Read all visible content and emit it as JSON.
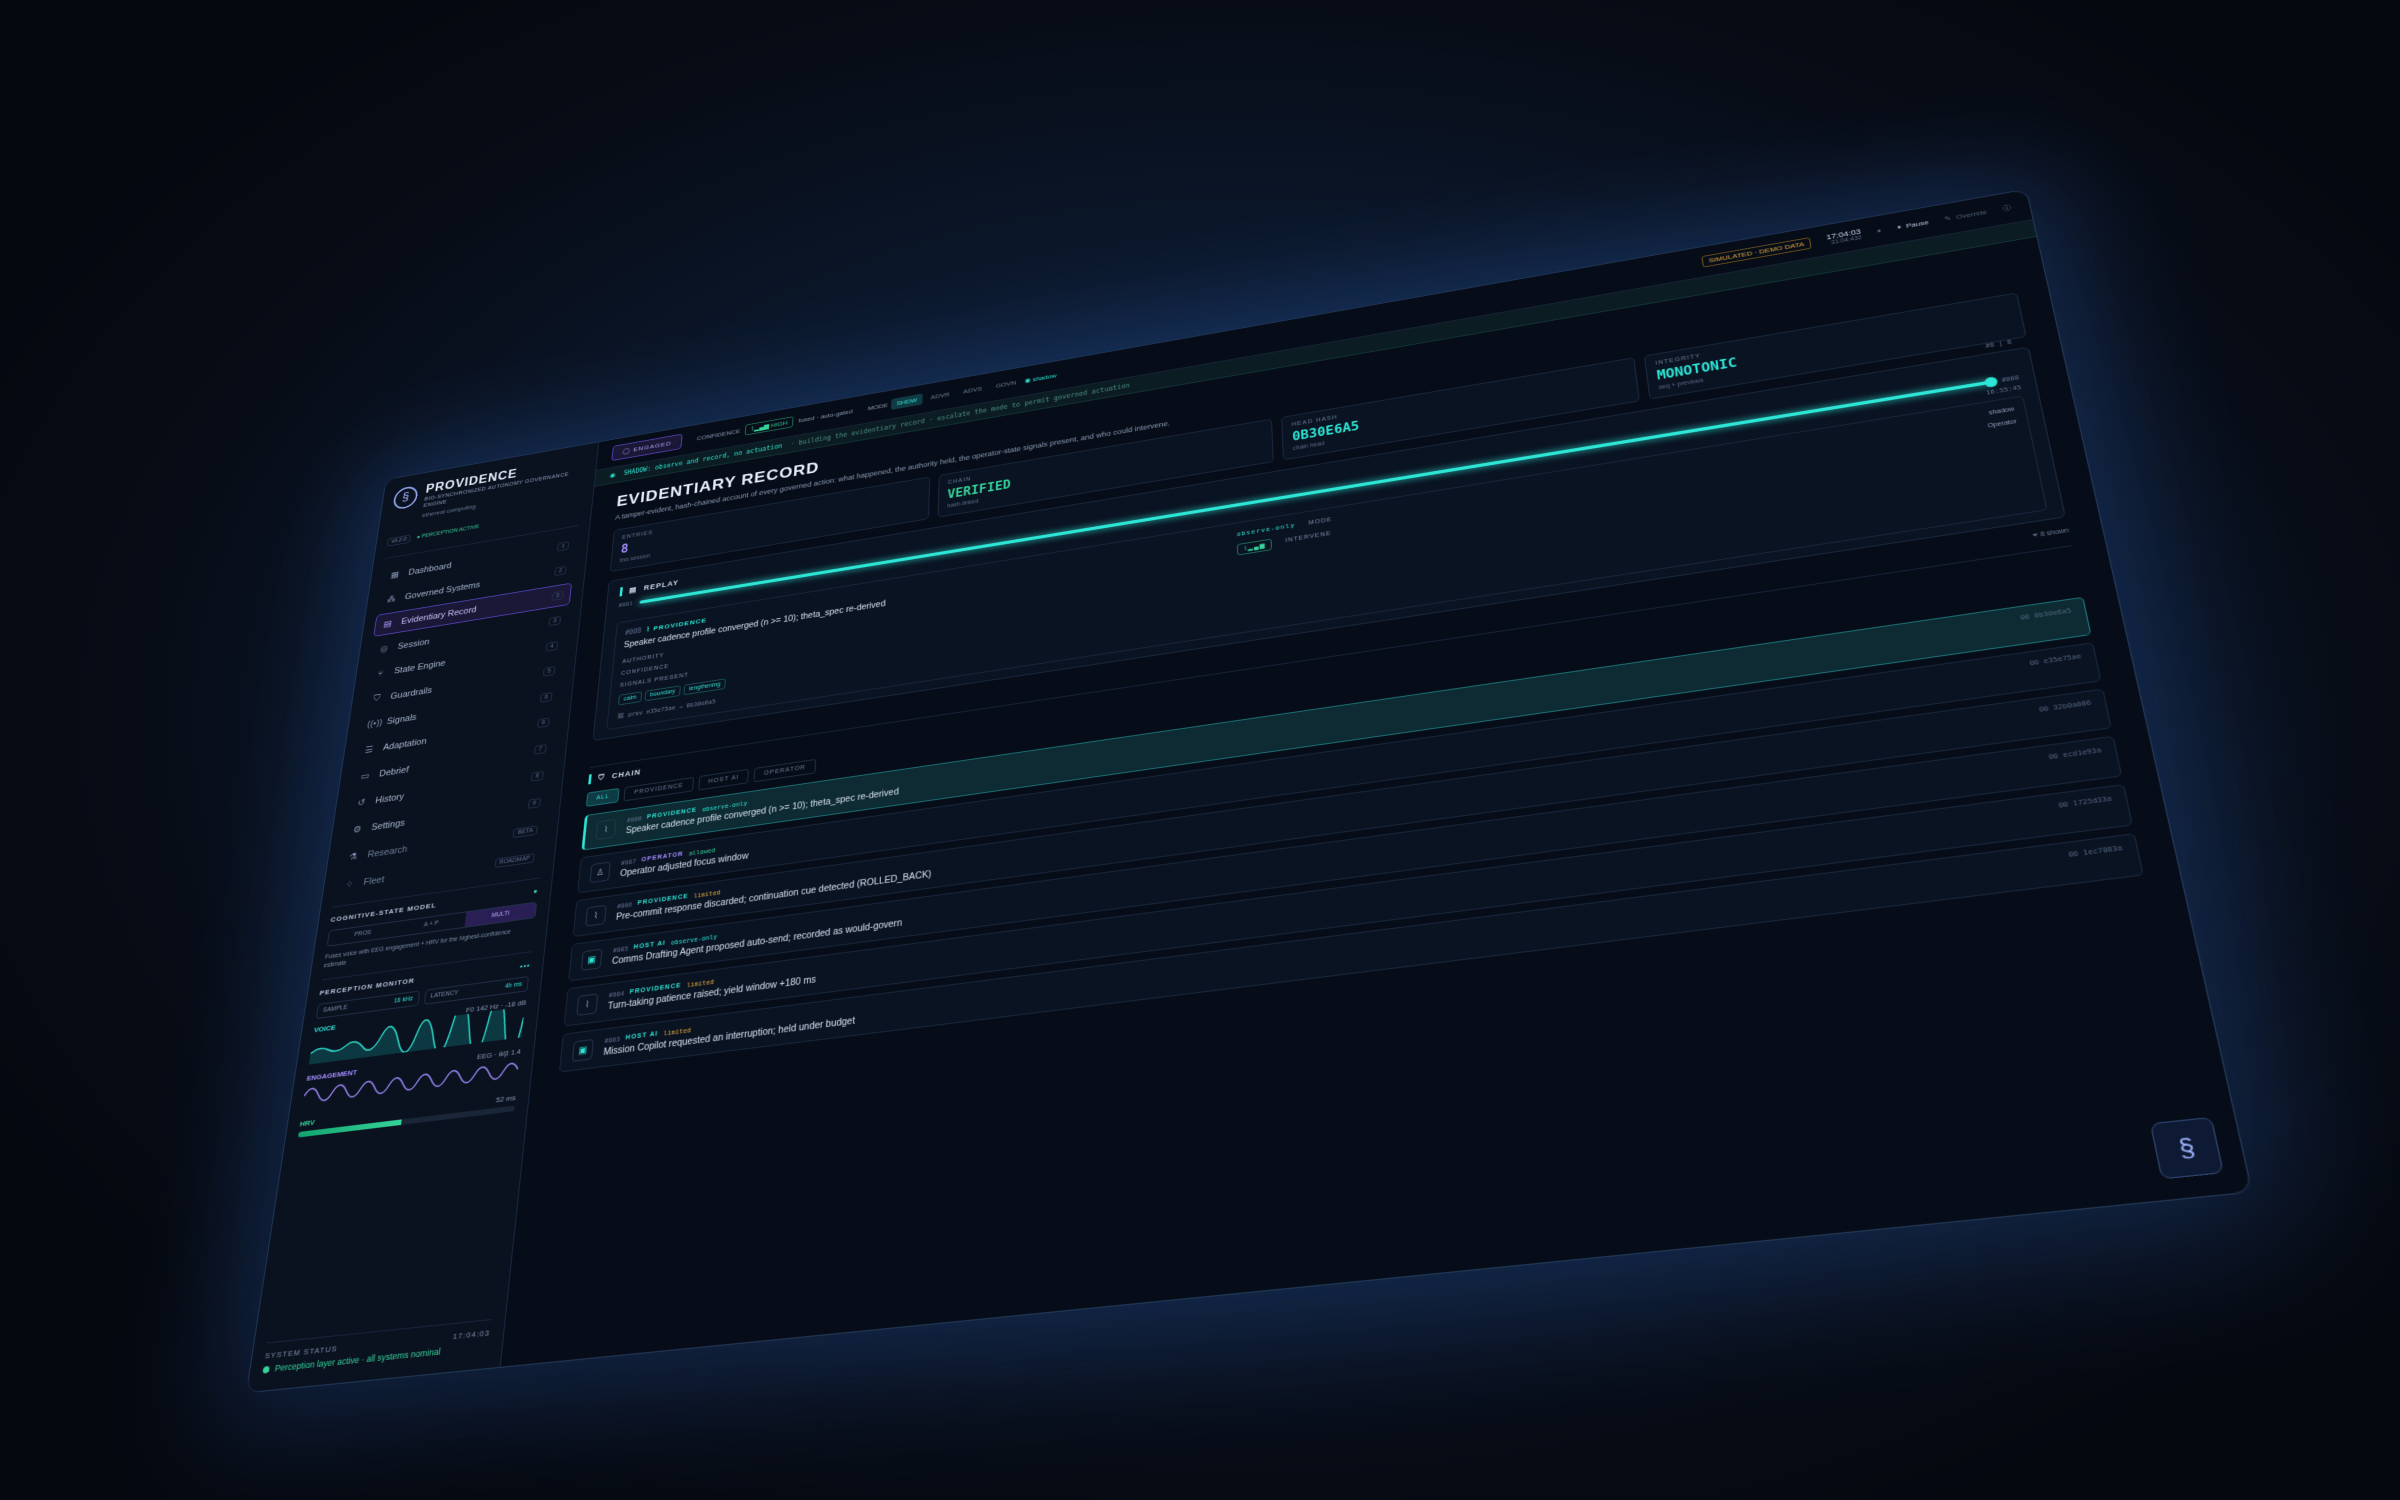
{
  "brand": {
    "name": "PROVIDENCE",
    "subtitle": "BIO-SYNCHRONIZED AUTONOMY GOVERNANCE ENGINE",
    "company": "ethereal computing",
    "version": "v0.2.0",
    "status": "PERCEPTION ACTIVE"
  },
  "nav": [
    {
      "label": "Dashboard",
      "key": "1",
      "icon": "grid-icon"
    },
    {
      "label": "Governed Systems",
      "key": "2",
      "icon": "nodes-icon"
    },
    {
      "label": "Evidentiary Record",
      "key": "3",
      "icon": "ledger-icon"
    },
    {
      "label": "Session",
      "key": "3",
      "icon": "session-icon"
    },
    {
      "label": "State Engine",
      "key": "4",
      "icon": "branch-icon"
    },
    {
      "label": "Guardrails",
      "key": "5",
      "icon": "shield-icon"
    },
    {
      "label": "Signals",
      "key": "6",
      "icon": "radio-icon"
    },
    {
      "label": "Adaptation",
      "key": "6",
      "icon": "sliders-icon"
    },
    {
      "label": "Debrief",
      "key": "7",
      "icon": "clipboard-icon"
    },
    {
      "label": "History",
      "key": "8",
      "icon": "history-icon"
    },
    {
      "label": "Settings",
      "key": "9",
      "icon": "gear-icon"
    },
    {
      "label": "Research",
      "key": "BETA",
      "icon": "flask-icon"
    },
    {
      "label": "Fleet",
      "key": "ROADMAP",
      "icon": "fleet-icon"
    }
  ],
  "cognitive": {
    "title": "COGNITIVE-STATE MODEL",
    "options": [
      "PROS",
      "A + P",
      "MULTI"
    ],
    "selected": 2,
    "desc": "Fuses voice with EEG engagement + HRV for the highest-confidence estimate"
  },
  "perception": {
    "title": "PERCEPTION MONITOR",
    "sample_label": "SAMPLE",
    "sample_value": "16 kHz",
    "latency_label": "LATENCY",
    "latency_value": "4h ms",
    "voice_label": "VOICE",
    "voice_meta": "F0 142 Hz · -18 dB",
    "engagement_label": "ENGAGEMENT",
    "engagement_meta": "EEG · θ/β 1.4",
    "hrv_label": "HRV",
    "hrv_meta": "52 ms",
    "hrv_level": 0.48
  },
  "system_status": {
    "label": "SYSTEM STATUS",
    "time": "17:04:03",
    "value": "Perception layer active · all systems nominal"
  },
  "topbar": {
    "engaged": "ENGAGED",
    "confidence_label": "CONFIDENCE",
    "confidence_value": "HIGH",
    "confidence_meta": "fused · auto-gated",
    "mode_label": "MODE",
    "modes": [
      "SHDW",
      "ADVR",
      "ADVS",
      "GOVN"
    ],
    "mode_selected": 0,
    "mode_state": "shadow",
    "sim": "SIMULATED · DEMO DATA",
    "clock": "17:04:03",
    "clock_sub": "31:04:432",
    "pause": "Pause",
    "override": "Override"
  },
  "banner": {
    "primary": "SHADOW: observe and record, no actuation",
    "secondary": "· building the evidentiary record · escalate the mode to permit governed actuation"
  },
  "page": {
    "title": "EVIDENTIARY RECORD",
    "subtitle": "A tamper-evident, hash-chained account of every governed action: what happened, the authority held, the operator-state signals present, and who could intervene."
  },
  "stats": [
    {
      "label": "ENTRIES",
      "value": "8",
      "sub": "this session",
      "color": "#a48cff"
    },
    {
      "label": "CHAIN",
      "value": "VERIFIED",
      "sub": "hash-linked",
      "color": "#35d399"
    },
    {
      "label": "HEAD HASH",
      "value": "0B30E6A5",
      "sub": "chain head",
      "color": "#2ee6d6"
    },
    {
      "label": "INTEGRITY",
      "value": "MONOTONIC",
      "sub": "seq + previous",
      "color": "#2ee6d6"
    }
  ],
  "replay": {
    "title": "REPLAY",
    "count": "#8 | 8",
    "start": "#001",
    "end": "#008",
    "time": "16:55:45",
    "event": {
      "num": "#008",
      "actor": "PROVIDENCE",
      "text": "Speaker cadence profile converged (n >= 10); theta_spec re-derived",
      "authority_label": "AUTHORITY",
      "authority_value": "observe-only",
      "confidence_label": "CONFIDENCE",
      "mode_label": "MODE",
      "mode_value": "shadow",
      "intervene_label": "INTERVENE",
      "intervene_value": "Operator",
      "signals_label": "SIGNALS PRESENT",
      "signals": [
        "calm",
        "boundary",
        "lengthening"
      ],
      "hash": "prev e35e75ae → 0b30e6a5"
    }
  },
  "chain": {
    "title": "CHAIN",
    "shown": "8 shown",
    "tabs": [
      "ALL",
      "PROVIDENCE",
      "HOST AI",
      "OPERATOR"
    ],
    "tab_selected": 0,
    "rows": [
      {
        "num": "#008",
        "actor": "PROVIDENCE",
        "state": "observe-only",
        "text": "Speaker cadence profile converged (n >= 10); theta_spec re-derived",
        "hash": "00 0b30e6a5",
        "kind": "prov"
      },
      {
        "num": "#007",
        "actor": "OPERATOR",
        "state": "allowed",
        "text": "Operator adjusted focus window",
        "hash": "00 e35e75ae",
        "kind": "op"
      },
      {
        "num": "#006",
        "actor": "PROVIDENCE",
        "state": "limited",
        "text": "Pre-commit response discarded; continuation cue detected (ROLLED_BACK)",
        "hash": "00 32b0a086",
        "kind": "prov"
      },
      {
        "num": "#005",
        "actor": "HOST AI",
        "state": "observe-only",
        "text": "Comms Drafting Agent proposed auto-send; recorded as would-govern",
        "hash": "00 ecd1e93a",
        "kind": "host"
      },
      {
        "num": "#004",
        "actor": "PROVIDENCE",
        "state": "limited",
        "text": "Turn-taking patience raised; yield window +180 ms",
        "hash": "00 1725d33a",
        "kind": "prov"
      },
      {
        "num": "#003",
        "actor": "HOST AI",
        "state": "limited",
        "text": "Mission Copilot requested an interruption; held under budget",
        "hash": "00 1ec7083a",
        "kind": "host"
      }
    ]
  }
}
